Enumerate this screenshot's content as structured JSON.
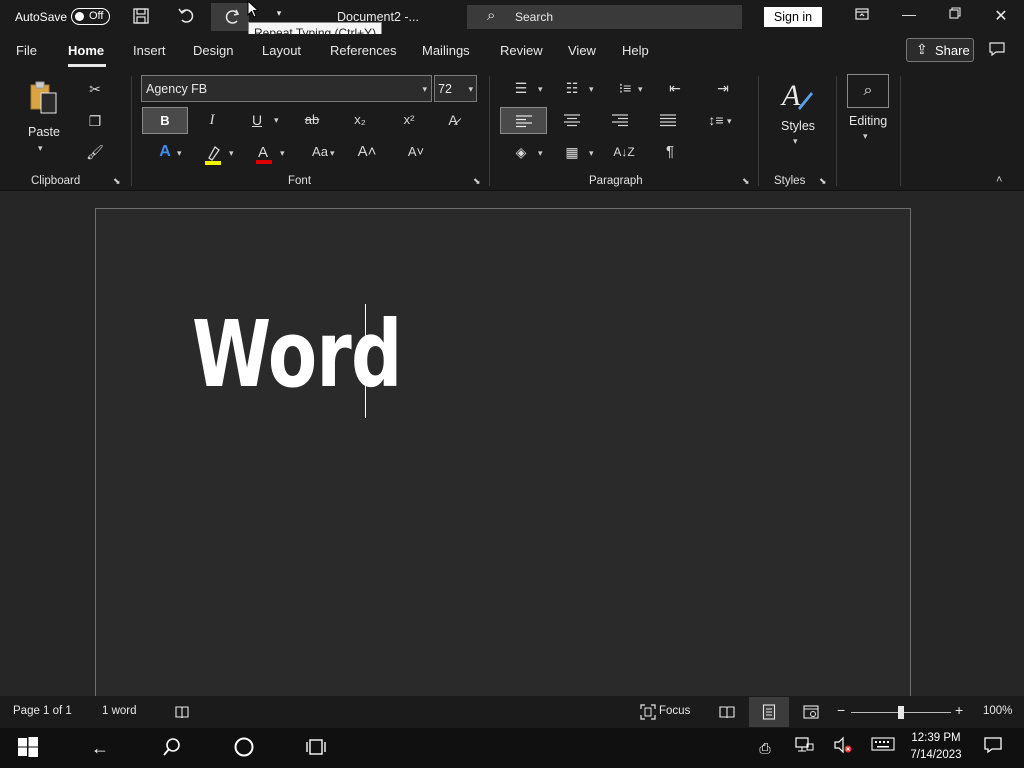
{
  "titlebar": {
    "autosave_label": "AutoSave",
    "autosave_state": "Off",
    "doc_title": "Document2  -...",
    "search_label": "Search",
    "signin_label": "Sign in",
    "tooltip": "Repeat Typing (Ctrl+Y)"
  },
  "tabs": [
    "File",
    "Home",
    "Insert",
    "Design",
    "Layout",
    "References",
    "Mailings",
    "Review",
    "View",
    "Help"
  ],
  "active_tab": "Home",
  "share_label": "Share",
  "ribbon": {
    "clipboard": {
      "paste_label": "Paste",
      "group_label": "Clipboard"
    },
    "font": {
      "font_name": "Agency FB",
      "font_size": "72",
      "group_label": "Font",
      "bold": "B",
      "italic": "I",
      "underline": "U",
      "strike": "ab",
      "subscript": "x₂",
      "superscript": "x²",
      "change_case": "Aa"
    },
    "paragraph": {
      "group_label": "Paragraph"
    },
    "styles": {
      "label": "Styles",
      "group_label": "Styles"
    },
    "editing": {
      "label": "Editing"
    }
  },
  "document": {
    "text": "Word"
  },
  "statusbar": {
    "page": "Page 1 of 1",
    "words": "1 word",
    "focus": "Focus",
    "zoom": "100%"
  },
  "taskbar": {
    "time": "12:39 PM",
    "date": "7/14/2023"
  },
  "colors": {
    "highlight_color": "#f2f200",
    "font_color": "#e00000",
    "text_effects_color": "#3d8df0"
  }
}
